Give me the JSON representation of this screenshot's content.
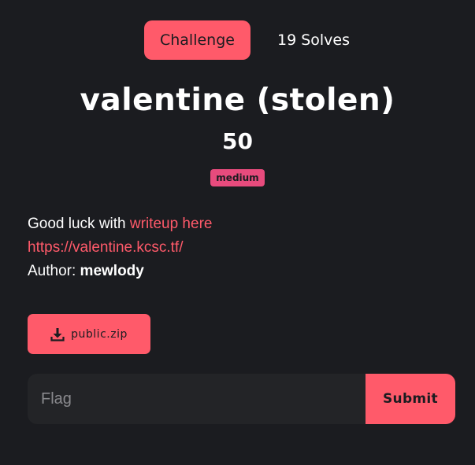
{
  "tabs": {
    "challenge_label": "Challenge",
    "solves_label": "19 Solves"
  },
  "challenge": {
    "name": "valentine (stolen)",
    "points": "50",
    "tag": "medium"
  },
  "description": {
    "line1_prefix": "Good luck with ",
    "line1_link": "writeup here",
    "url": "https://valentine.kcsc.tf/",
    "author_prefix": "Author: ",
    "author_name": "mewlody"
  },
  "files": {
    "download_label": "public.zip",
    "icon": "download-icon"
  },
  "flag_form": {
    "placeholder": "Flag",
    "value": "",
    "submit_label": "Submit"
  },
  "colors": {
    "accent": "#ff5a6a",
    "tag": "#e84b7d",
    "background": "#1b1c20",
    "input_bg": "#232427"
  }
}
